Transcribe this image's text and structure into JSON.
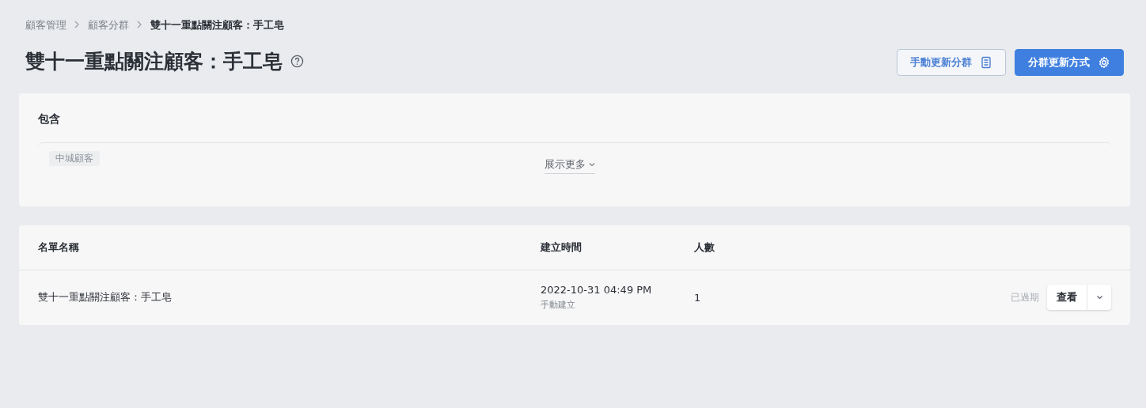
{
  "breadcrumb": [
    {
      "label": "顧客管理",
      "current": false
    },
    {
      "label": "顧客分群",
      "current": false
    },
    {
      "label": "雙十一重點關注顧客：手工皂",
      "current": true
    }
  ],
  "title": "雙十一重點關注顧客：手工皂",
  "actions": [
    {
      "label": "手動更新分群",
      "kind": "secondary"
    },
    {
      "label": "分群更新方式",
      "kind": "primary"
    }
  ],
  "include": {
    "heading": "包含",
    "tags": [
      "中城顧客"
    ],
    "show_more": "展示更多"
  },
  "table": {
    "columns": [
      "名單名稱",
      "建立時間",
      "人數"
    ],
    "rows": [
      {
        "name": "雙十一重點關注顧客：手工皂",
        "created": "2022-10-31 04:49 PM",
        "created_by": "手動建立",
        "count": "1",
        "status": "已過期",
        "view": "查看"
      }
    ]
  }
}
